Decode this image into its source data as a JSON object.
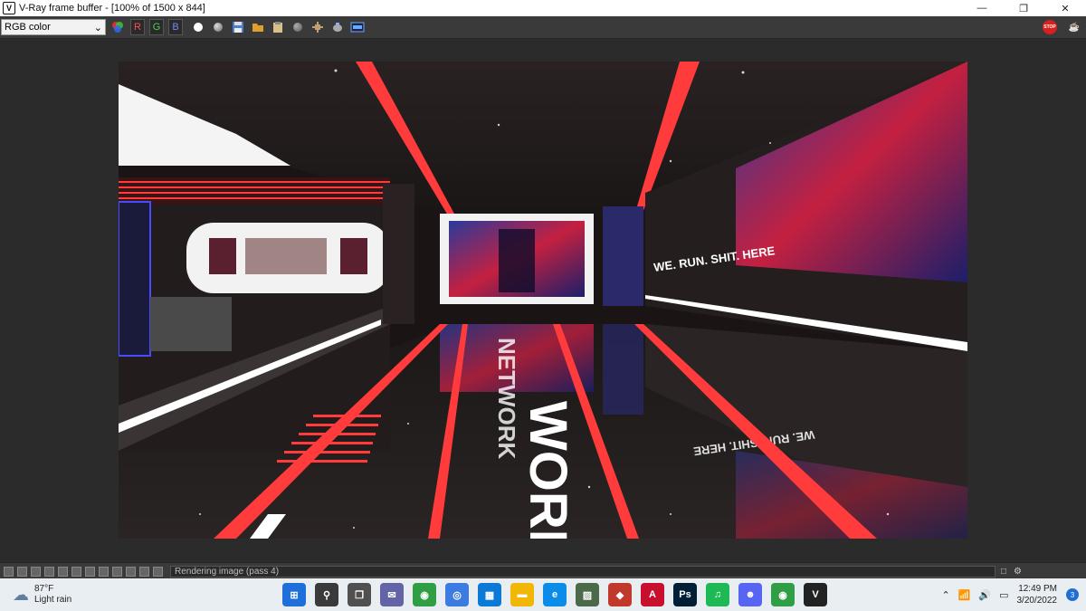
{
  "window": {
    "title": "V-Ray frame buffer - [100% of 1500 x 844]",
    "app_icon_glyph": "V",
    "minimize_glyph": "—",
    "restore_glyph": "❐",
    "close_glyph": "✕"
  },
  "toolbar": {
    "channel_value": "RGB color",
    "channel_arrow": "⌄",
    "r_label": "R",
    "g_label": "G",
    "b_label": "B",
    "stop_label": "STOP",
    "teapot_glyph": "☕"
  },
  "render": {
    "top_sign": "WE. RUN. SHIT. HERE",
    "mirrored_sign": "WE. RUN. SHIT. HERE",
    "floor_text": "WORK",
    "floor_text_2": "NETWORK",
    "colors": {
      "red": "#ff3b3b",
      "dark": "#1a1414"
    }
  },
  "statusbar": {
    "status_text": "Rendering image (pass 4)",
    "expand_glyph": "□",
    "settings_glyph": "⚙"
  },
  "taskbar": {
    "weather_temp": "87°F",
    "weather_desc": "Light rain",
    "weather_icon": "☁",
    "time": "12:49 PM",
    "date": "3/20/2022",
    "notifications": "3",
    "tray_chevron": "⌃",
    "tray_wifi": "📶",
    "tray_sound": "🔊",
    "tray_battery": "▭",
    "apps": [
      {
        "name": "windows-start",
        "glyph": "⊞",
        "color": "#1e6fd9"
      },
      {
        "name": "search",
        "glyph": "⚲",
        "color": "#3a3a3a"
      },
      {
        "name": "task-view",
        "glyph": "❐",
        "color": "#505050"
      },
      {
        "name": "chat",
        "glyph": "✉",
        "color": "#6264a7"
      },
      {
        "name": "chrome",
        "glyph": "◉",
        "color": "#2f9e44"
      },
      {
        "name": "browser",
        "glyph": "◎",
        "color": "#3c7be0"
      },
      {
        "name": "store",
        "glyph": "▦",
        "color": "#0a7ad6"
      },
      {
        "name": "file-explorer",
        "glyph": "▬",
        "color": "#f2b705"
      },
      {
        "name": "edge",
        "glyph": "e",
        "color": "#0c8ce9"
      },
      {
        "name": "photos",
        "glyph": "▨",
        "color": "#4a6a4a"
      },
      {
        "name": "sketchup",
        "glyph": "◆",
        "color": "#c0392b"
      },
      {
        "name": "autocad",
        "glyph": "A",
        "color": "#c8102e"
      },
      {
        "name": "photoshop",
        "glyph": "Ps",
        "color": "#001e36"
      },
      {
        "name": "spotify",
        "glyph": "♫",
        "color": "#1db954"
      },
      {
        "name": "discord",
        "glyph": "☻",
        "color": "#5865f2"
      },
      {
        "name": "chrome-2",
        "glyph": "◉",
        "color": "#2f9e44"
      },
      {
        "name": "vray",
        "glyph": "V",
        "color": "#222222"
      }
    ]
  }
}
